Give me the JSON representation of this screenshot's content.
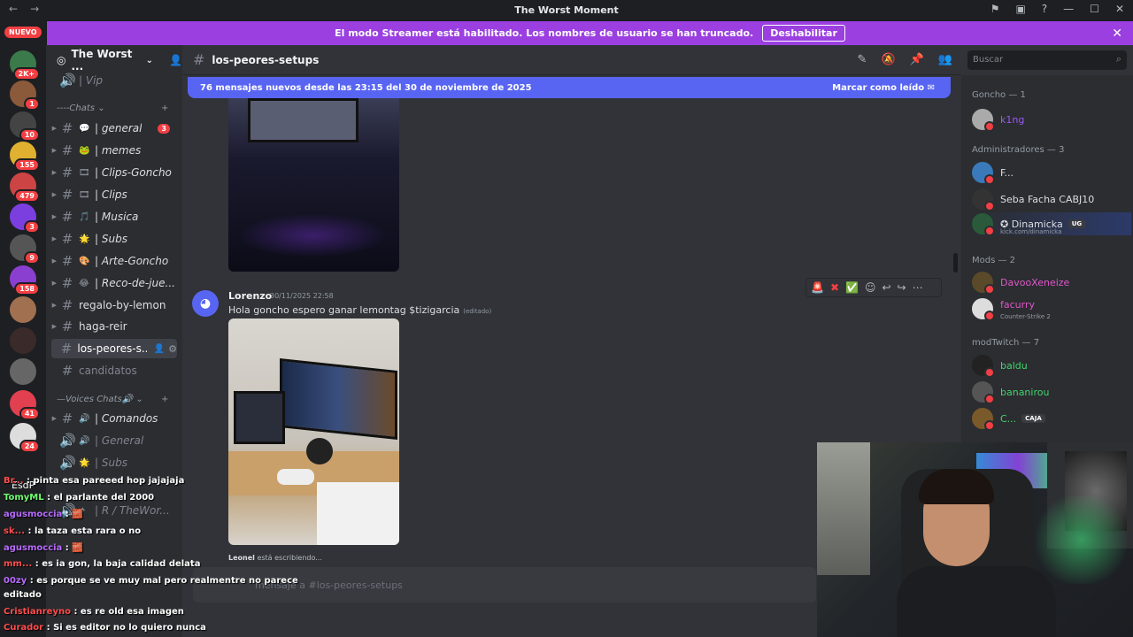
{
  "window": {
    "title": "The Worst Moment"
  },
  "streamer_banner": {
    "text": "El modo Streamer está habilitado. Los nombres de usuario se han truncado.",
    "button": "Deshabilitar"
  },
  "guilds": {
    "nuevo_badge": "NUEVO",
    "badges": [
      "2K+",
      "1",
      "10",
      "155",
      "479",
      "3",
      "9",
      "158",
      "41",
      "24"
    ],
    "footer_label": "EsdP"
  },
  "server": {
    "name": "The Worst ...",
    "top_channel": "| Vip",
    "chats_category": "----Chats",
    "voices_category": "—Voices Chats🔊",
    "channels": [
      {
        "emoji": "💬",
        "label": "| general",
        "badge": "3"
      },
      {
        "emoji": "🐸",
        "label": "| memes"
      },
      {
        "emoji": "🎞",
        "label": "| Clips-Goncho"
      },
      {
        "emoji": "🎞",
        "label": "| Clips"
      },
      {
        "emoji": "🎵",
        "label": "| Musica"
      },
      {
        "emoji": "🌟",
        "label": "| Subs"
      },
      {
        "emoji": "🎨",
        "label": "| Arte-Goncho"
      },
      {
        "emoji": "😂",
        "label": "| Reco-de-jue..."
      },
      {
        "label": "regalo-by-lemon"
      },
      {
        "label": "haga-reir"
      },
      {
        "label": "los-peores-s..."
      },
      {
        "label": "candidatos"
      }
    ],
    "voice_channels": [
      {
        "emoji": "🔊",
        "label": "| Comandos"
      },
      {
        "emoji": "🔊",
        "label": "| General"
      },
      {
        "emoji": "🌟",
        "label": "| Subs"
      },
      {
        "emoji": "✦",
        "label": "| R / TheWor..."
      }
    ]
  },
  "topbar": {
    "channel_name": "los-peores-setups"
  },
  "search": {
    "placeholder": "Buscar"
  },
  "new_messages": {
    "text": "76 mensajes nuevos desde las 23:15 del 30 de noviembre de 2025",
    "mark_read": "Marcar como leído"
  },
  "message": {
    "author": "Lorenzo",
    "timestamp": "30/11/2025 22:58",
    "text": "Hola goncho espero ganar lemontag  $tizigarcia",
    "edited": "(editado)"
  },
  "typing": {
    "user": "Leonel",
    "rest": "está escribiendo..."
  },
  "composer": {
    "placeholder": "mensaje a #los-peores-setups"
  },
  "members": {
    "groups": [
      {
        "title": "Goncho — 1",
        "items": [
          {
            "name": "k1ng",
            "color": "#9b59f6"
          }
        ]
      },
      {
        "title": "Administradores — 3",
        "items": [
          {
            "name": "F...",
            "color": "#dbdee1"
          },
          {
            "name": "Seba Facha CABJ10",
            "color": "#dbdee1"
          },
          {
            "name": "✪ Dinamicka",
            "color": "#dbdee1",
            "tag": "UG",
            "sub": "kick.com/dinamicka"
          }
        ]
      },
      {
        "title": "Mods — 2",
        "items": [
          {
            "name": "DavooXeneize",
            "color": "#e056c8"
          },
          {
            "name": "facurry",
            "color": "#e056c8",
            "sub": "Counter-Strike 2"
          }
        ]
      },
      {
        "title": "modTwitch — 7",
        "items": [
          {
            "name": "baldu",
            "color": "#43d46c"
          },
          {
            "name": "bananirou",
            "color": "#43d46c"
          },
          {
            "name": "C...",
            "color": "#43d46c",
            "tag": "CAJA"
          }
        ]
      }
    ]
  },
  "stream_chat": [
    {
      "user": "Br...",
      "msg": ": pinta esa pareeed hop jajajaja"
    },
    {
      "user": "TomyML",
      "msg": ": el parlante del 2000"
    },
    {
      "user": "agusmoccia",
      "msg": ": 🧱"
    },
    {
      "user": "sk...",
      "msg": ": la taza esta rara o no"
    },
    {
      "user": "agusmoccia",
      "msg": ": 🧱"
    },
    {
      "user": "mm...",
      "msg": ": es ia gon, la baja calidad delata"
    },
    {
      "user": "00zy",
      "msg": ": es porque se ve muy mal pero realmentre no parece"
    },
    {
      "user": "",
      "msg": "editado"
    },
    {
      "user": "Cristianreyno",
      "msg": ": es re old esa imagen"
    },
    {
      "user": "Curador",
      "msg": ": Si es editor no lo quiero nunca"
    }
  ]
}
